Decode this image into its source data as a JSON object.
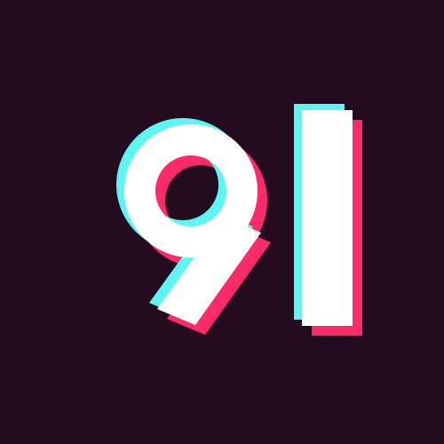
{
  "logo": {
    "text": "91",
    "colors": {
      "background": "#230c1f",
      "glyph": "#ffffff",
      "cyan_shadow": "#5cf5f1",
      "pink_shadow": "#fb2b6a"
    }
  }
}
